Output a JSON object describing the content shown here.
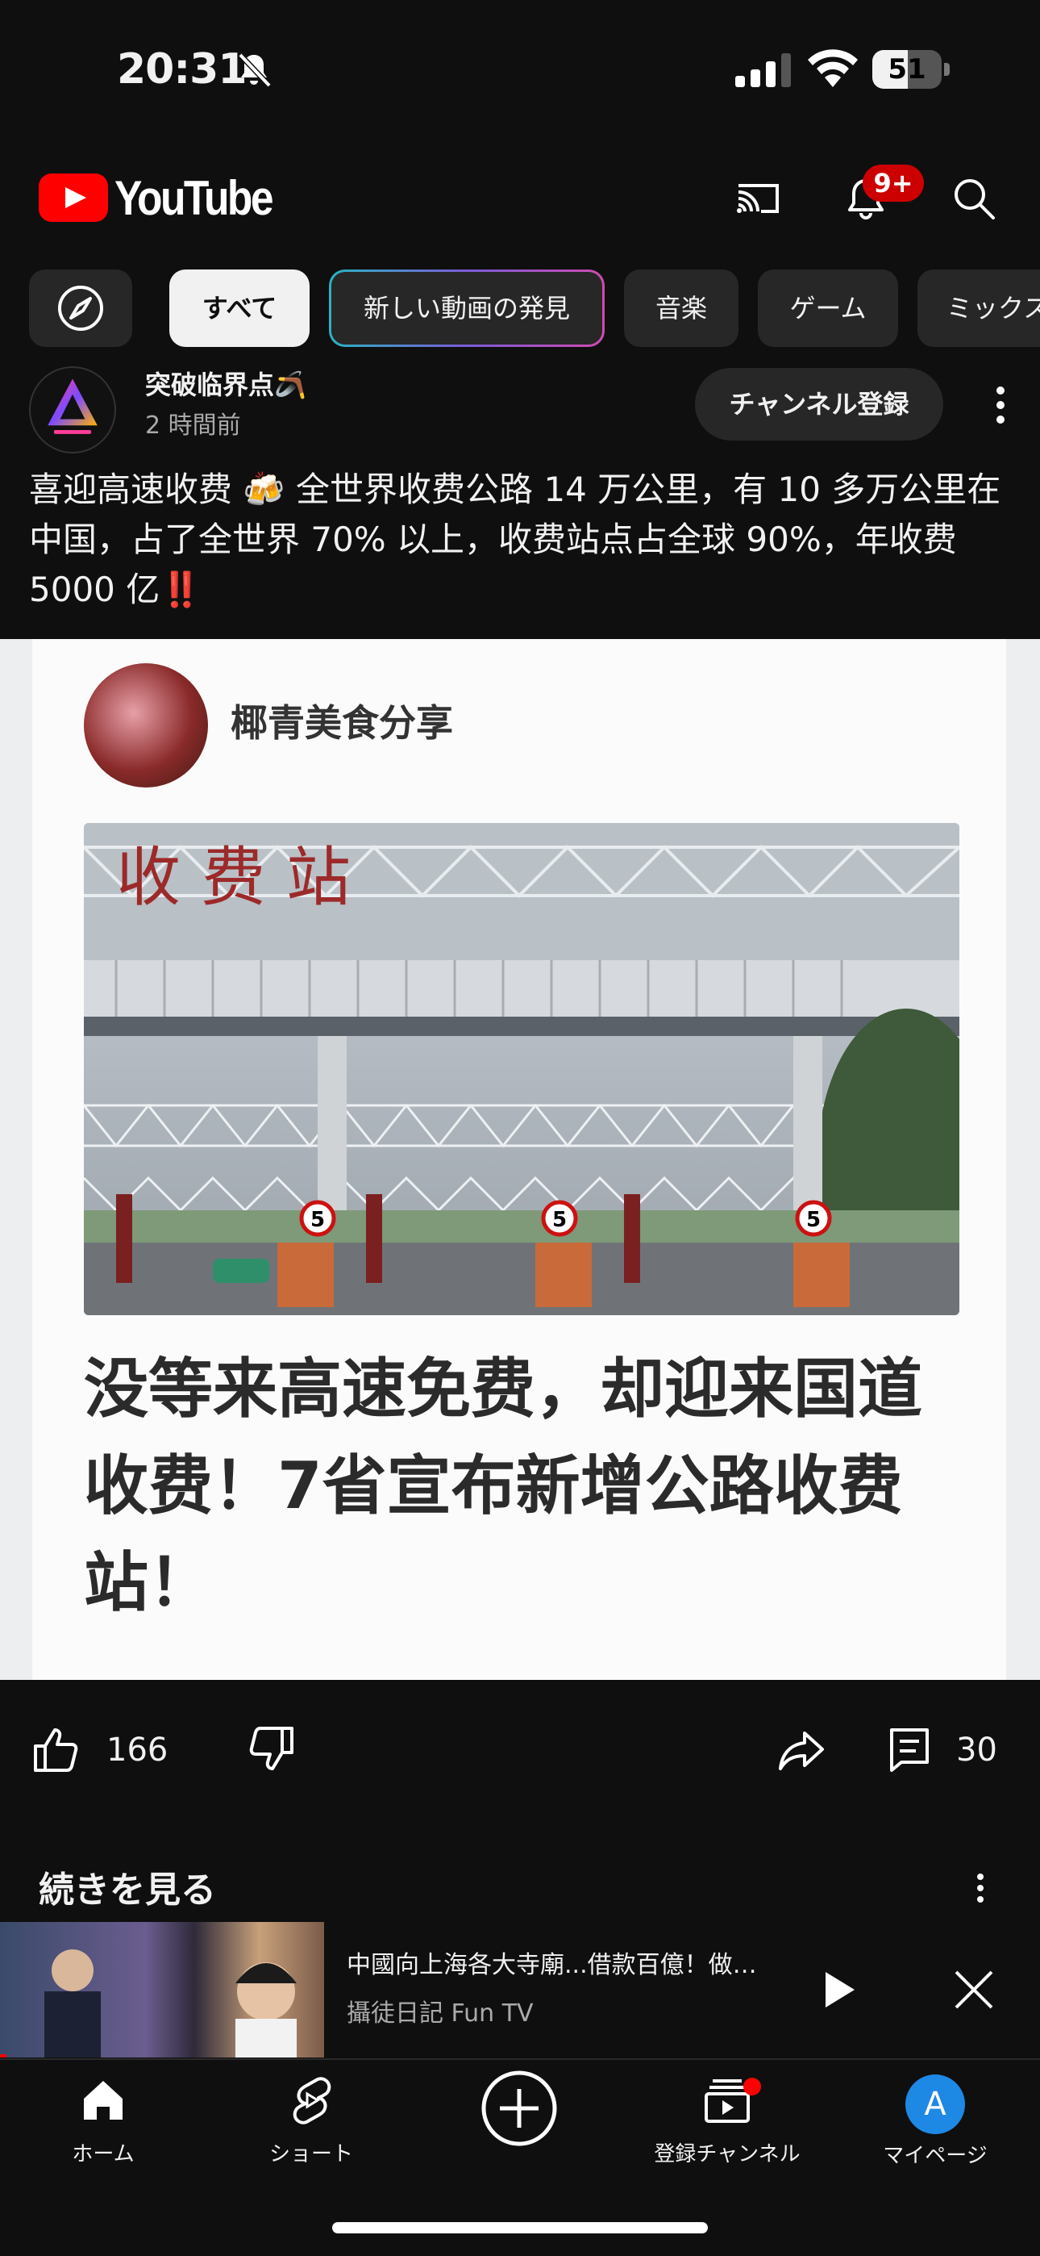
{
  "status_bar": {
    "time": "20:31",
    "battery": "51",
    "battery_level": 0.51
  },
  "header": {
    "logo_text": "YouTube",
    "notification_badge": "9+"
  },
  "chips": [
    {
      "label": "",
      "icon": "compass-icon"
    },
    {
      "label": "すべて",
      "selected": true
    },
    {
      "label": "新しい動画の発見"
    },
    {
      "label": "音楽"
    },
    {
      "label": "ゲーム"
    },
    {
      "label": "ミックス"
    }
  ],
  "post": {
    "channel_name": "突破临界点🪃",
    "time_ago": "2 時間前",
    "subscribe_label": "チャンネル登録",
    "text": "喜迎高速收费 🍻 全世界收费公路 14 万公里，有 10 多万公里在中国，占了全世界 70% 以上，收费站点占全球 90%，年收费 5000 亿‼️",
    "image": {
      "source_name": "椰青美食分享",
      "sign_text": "收 费 站",
      "lane_sign": "5",
      "headline": "没等来高速免费，却迎来国道收费！7省宣布新增公路收费站！"
    },
    "likes": "166",
    "comments": "30"
  },
  "continue": {
    "title": "続きを見る",
    "video_title": "中國向上海各大寺廟...借款百億！做…",
    "video_channel": "攝徒日記 Fun TV",
    "progress": 0.02
  },
  "bottom_nav": {
    "home": "ホーム",
    "shorts": "ショート",
    "subscriptions": "登録チャンネル",
    "me": "マイページ",
    "me_initial": "A"
  },
  "colors": {
    "accent": "#ff0000",
    "background": "#0f0f0f",
    "chip_bg": "#272727",
    "avatar_blue": "#1e88e5"
  }
}
